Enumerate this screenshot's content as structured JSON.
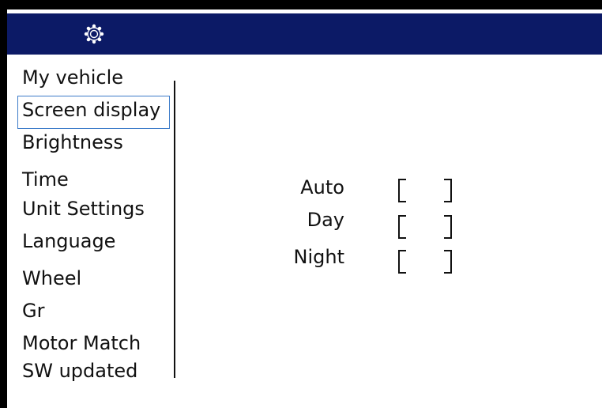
{
  "header": {
    "icon": "settings-gear-icon",
    "background_color": "#0c1a66"
  },
  "sidebar": {
    "selected": "Screen display",
    "items": [
      {
        "label": "My vehicle"
      },
      {
        "label": "Screen display"
      },
      {
        "label": "Brightness"
      },
      {
        "label": "Time"
      },
      {
        "label": "Unit Settings"
      },
      {
        "label": "Language"
      },
      {
        "label": "Wheel"
      },
      {
        "label": "Gr"
      },
      {
        "label": "Motor Match"
      },
      {
        "label": "SW updated"
      }
    ]
  },
  "display_mode": {
    "options": [
      {
        "label": "Auto",
        "checked": false
      },
      {
        "label": "Day",
        "checked": false
      },
      {
        "label": "Night",
        "checked": false
      }
    ]
  },
  "colors": {
    "selection_border": "#3d7cc9",
    "text": "#111111"
  }
}
